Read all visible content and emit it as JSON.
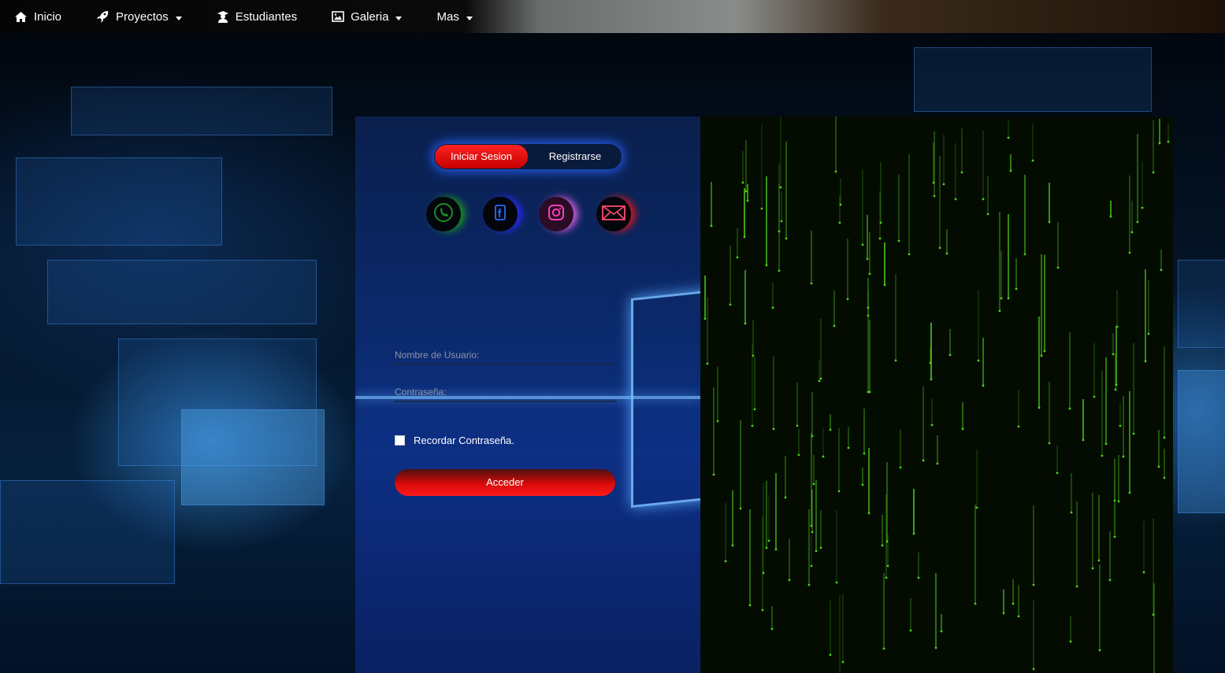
{
  "nav": {
    "items": [
      {
        "label": "Inicio",
        "icon": "home-icon",
        "dropdown": false
      },
      {
        "label": "Proyectos",
        "icon": "rocket-icon",
        "dropdown": true
      },
      {
        "label": "Estudiantes",
        "icon": "graduate-icon",
        "dropdown": false
      },
      {
        "label": "Galeria",
        "icon": "image-icon",
        "dropdown": true
      },
      {
        "label": "Mas",
        "icon": "",
        "dropdown": true
      }
    ]
  },
  "login": {
    "tabs": {
      "login_label": "Iniciar Sesion",
      "register_label": "Registrarse"
    },
    "social": [
      "whatsapp-icon",
      "facebook-icon",
      "instagram-icon",
      "mail-icon"
    ],
    "username_placeholder": "Nombre de Usuario:",
    "password_placeholder": "Contraseña:",
    "remember_label": "Recordar Contraseña.",
    "submit_label": "Acceder"
  },
  "colors": {
    "accent_red": "#e01010",
    "accent_blue": "#2a5cff",
    "matrix_green": "#4fd21a"
  }
}
